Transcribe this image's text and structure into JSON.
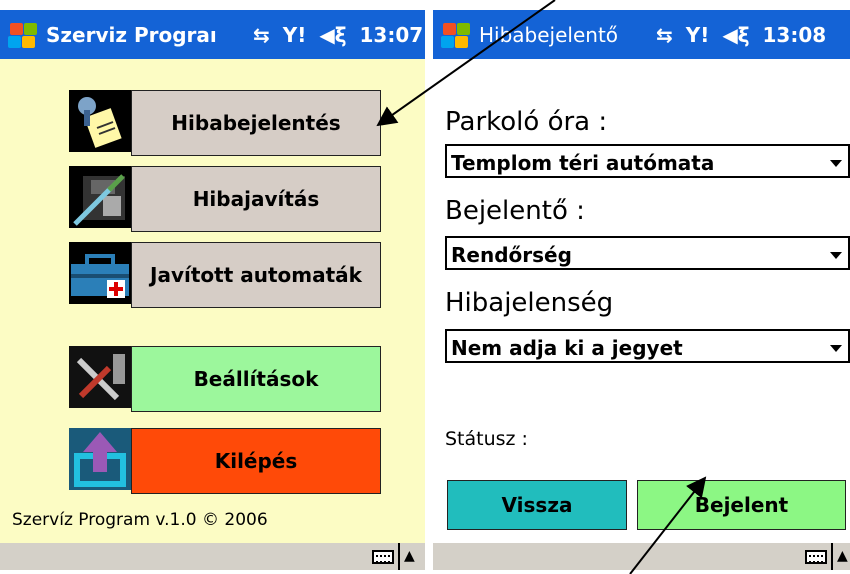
{
  "left_screen": {
    "title": "Szerviz Prograı",
    "status": {
      "connectivity_icon": "sync-icon",
      "signal_icon": "antenna-icon",
      "volume_icon": "speaker-icon",
      "time": "13:07"
    },
    "buttons": [
      {
        "label": "Hibabejelentés",
        "icon": "notepad-pushpin-icon",
        "color": "#d6cdc6"
      },
      {
        "label": "Hibajavítás",
        "icon": "floppy-screwdriver-icon",
        "color": "#d6cdc6"
      },
      {
        "label": "Javított automaták",
        "icon": "toolbox-icon",
        "color": "#d6cdc6"
      },
      {
        "label": "Beállítások",
        "icon": "tools-icon",
        "color": "#9cf79c"
      },
      {
        "label": "Kilépés",
        "icon": "exit-up-arrow-icon",
        "color": "#ff4a08"
      }
    ],
    "footer": "Szervíz Program  v.1.0  © 2006"
  },
  "right_screen": {
    "title": "Hibabejelentő",
    "status": {
      "connectivity_icon": "sync-icon",
      "signal_icon": "antenna-icon",
      "volume_icon": "speaker-icon",
      "time": "13:08"
    },
    "fields": [
      {
        "label": "Parkoló óra :",
        "value": "Templom téri autómata"
      },
      {
        "label": "Bejelentő :",
        "value": "Rendőrség"
      },
      {
        "label": "Hibajelenség",
        "value": "Nem adja ki a jegyet"
      }
    ],
    "status_label": "Státusz :",
    "buttons": {
      "back": {
        "label": "Vissza",
        "color": "#21bdbd"
      },
      "submit": {
        "label": "Bejelent",
        "color": "#8cf784"
      }
    }
  },
  "menubar": {
    "keyboard_icon": "keyboard-icon",
    "arrow_icon": "up-arrow-icon"
  },
  "colors": {
    "titlebar": "#1463d6",
    "left_bg": "#fcfcc4",
    "menubar": "#d4d0c8"
  }
}
